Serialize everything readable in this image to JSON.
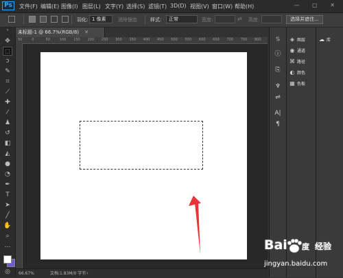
{
  "app": {
    "logo": "Ps",
    "menu": [
      "文件(F)",
      "编辑(E)",
      "图像(I)",
      "图层(L)",
      "文字(Y)",
      "选择(S)",
      "滤镜(T)",
      "3D(D)",
      "视图(V)",
      "窗口(W)",
      "帮助(H)"
    ],
    "window_controls": "— ▢ ✕"
  },
  "options_bar": {
    "feather_label": "羽化:",
    "feather_value": "1 像素",
    "antialias_label": "消除锯齿",
    "style_label": "样式:",
    "style_value": "正常",
    "width_label": "宽度:",
    "height_label": "高度:",
    "select_mask_button": "选择并遮住..."
  },
  "document": {
    "tab_title": "未标题-1 @ 66.7%(RGB/8)",
    "ruler_numbers": [
      "50",
      "0",
      "50",
      "100",
      "150",
      "200",
      "250",
      "300",
      "350",
      "400",
      "450",
      "500",
      "550",
      "600",
      "650",
      "700",
      "750",
      "800"
    ],
    "selection_active": true
  },
  "status_bar": {
    "zoom": "66.67%",
    "doc_info": "文档:1.83M/0 字节"
  },
  "panels": {
    "list": [
      {
        "icon": "layers-icon",
        "glyph": "◈",
        "label": "图层"
      },
      {
        "icon": "channels-icon",
        "glyph": "◉",
        "label": "通道"
      },
      {
        "icon": "paths-icon",
        "glyph": "⌘",
        "label": "路径"
      },
      {
        "icon": "color-icon",
        "glyph": "◐",
        "label": "颜色"
      },
      {
        "icon": "swatches-icon",
        "glyph": "▦",
        "label": "色板"
      }
    ],
    "library_label": "库"
  },
  "colors": {
    "foreground": "#ffffff",
    "background": "#6b5bd6",
    "annotation_arrow": "#e8353a"
  },
  "watermark": {
    "brand": "Bai",
    "brand_suffix": "度",
    "product": "经验",
    "url": "jingyan.baidu.com"
  }
}
